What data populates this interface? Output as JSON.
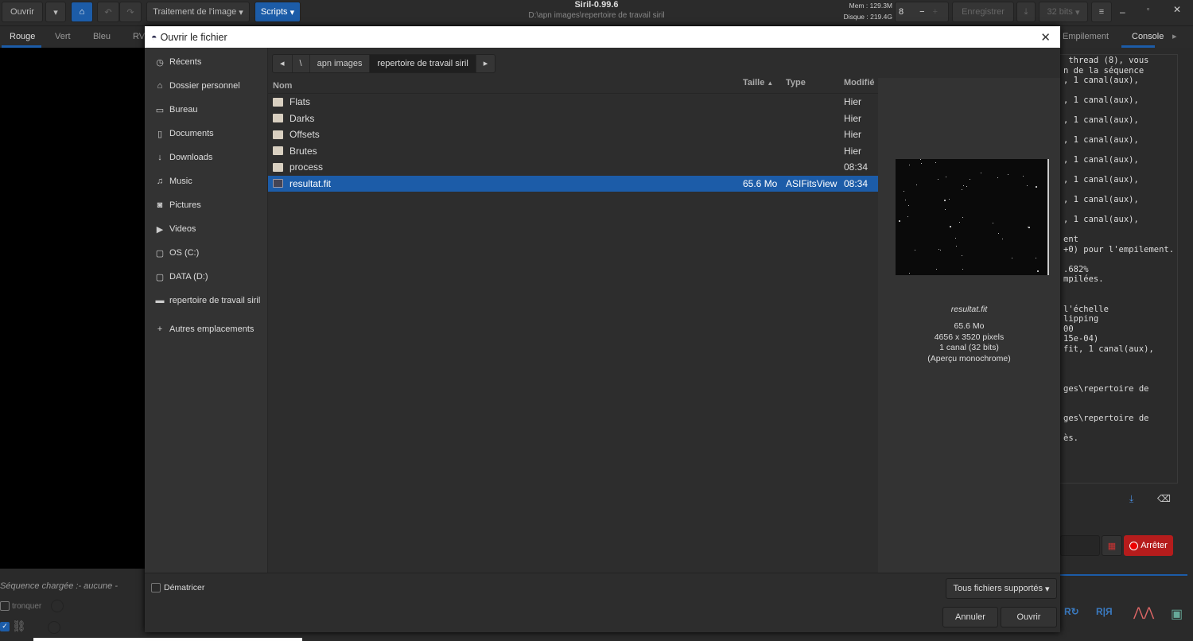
{
  "app": {
    "title": "Siril-0.99.6",
    "path": "D:\\apn images\\repertoire de travail siril",
    "mem": "Mem : 129.3M",
    "disk": "Disque : 219.4G",
    "threads": "8",
    "open_label": "Ouvrir",
    "processing_label": "Traitement de l'image",
    "scripts_label": "Scripts",
    "save_label": "Enregistrer",
    "bits_label": "32 bits"
  },
  "tabs": [
    "Rouge",
    "Vert",
    "Bleu",
    "RVB"
  ],
  "right_tabs": [
    "Empilement",
    "Console"
  ],
  "console_lines": [
    " thread (8), vous",
    "n de la séquence",
    ", 1 canal(aux),",
    "",
    ", 1 canal(aux),",
    "",
    ", 1 canal(aux),",
    "",
    ", 1 canal(aux),",
    "",
    ", 1 canal(aux),",
    "",
    ", 1 canal(aux),",
    "",
    ", 1 canal(aux),",
    "",
    ", 1 canal(aux),",
    "",
    "ent",
    "+0) pour l'empilement.",
    "",
    ".682%",
    "mpilées.",
    "",
    "",
    "l'échelle",
    "lipping",
    "00",
    "15e-04)",
    "fit, 1 canal(aux),",
    "",
    "",
    "",
    "ges\\repertoire de",
    "",
    "",
    "ges\\repertoire de",
    "",
    "ès."
  ],
  "stop_label": "Arrêter",
  "sequence": {
    "label": "Séquence chargée :- aucune -",
    "truncate": "tronquer"
  },
  "dialog": {
    "title": "Ouvrir le fichier",
    "places": [
      {
        "icon": "clock",
        "label": "Récents"
      },
      {
        "icon": "home",
        "label": "Dossier personnel"
      },
      {
        "icon": "desktop",
        "label": "Bureau"
      },
      {
        "icon": "document",
        "label": "Documents"
      },
      {
        "icon": "download",
        "label": "Downloads"
      },
      {
        "icon": "music",
        "label": "Music"
      },
      {
        "icon": "camera",
        "label": "Pictures"
      },
      {
        "icon": "video",
        "label": "Videos"
      },
      {
        "icon": "drive",
        "label": "OS (C:)"
      },
      {
        "icon": "drive",
        "label": "DATA (D:)"
      },
      {
        "icon": "folder",
        "label": "repertoire de travail siril"
      }
    ],
    "other_locations": "Autres emplacements",
    "breadcrumb": [
      "\\",
      "apn images",
      "repertoire de travail siril"
    ],
    "columns": [
      "Nom",
      "Taille",
      "Type",
      "Modifié"
    ],
    "files": [
      {
        "name": "Flats",
        "size": "",
        "type": "",
        "modified": "Hier",
        "folder": true
      },
      {
        "name": "Darks",
        "size": "",
        "type": "",
        "modified": "Hier",
        "folder": true
      },
      {
        "name": "Offsets",
        "size": "",
        "type": "",
        "modified": "Hier",
        "folder": true
      },
      {
        "name": "Brutes",
        "size": "",
        "type": "",
        "modified": "Hier",
        "folder": true
      },
      {
        "name": "process",
        "size": "",
        "type": "",
        "modified": "08:34",
        "folder": true
      },
      {
        "name": "resultat.fit",
        "size": "65.6 Mo",
        "type": "ASIFitsView",
        "modified": "08:34",
        "folder": false,
        "selected": true
      }
    ],
    "preview": {
      "name": "resultat.fit",
      "size": "65.6 Mo",
      "dims": "4656 x 3520 pixels",
      "channels": "1 canal (32 bits)",
      "note": "(Aperçu monochrome)"
    },
    "debayer": "Dématricer",
    "filter": "Tous fichiers supportés",
    "cancel": "Annuler",
    "open": "Ouvrir"
  }
}
